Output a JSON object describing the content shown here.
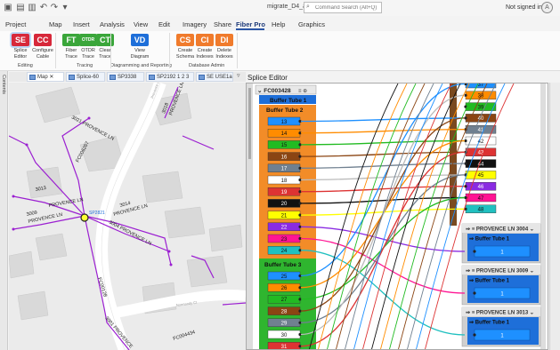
{
  "titlebar": {
    "title": "migrate_D4_alt",
    "search_placeholder": "Command Search (Alt+Q)",
    "signin": "Not signed in",
    "avatar": "A"
  },
  "tabs": [
    "Project",
    "Map",
    "Insert",
    "Analysis",
    "View",
    "Edit",
    "Imagery",
    "Share",
    "Fiber Pro",
    "Help",
    "Graphics"
  ],
  "active_tab": "Fiber Pro",
  "ribbon": {
    "buttons": [
      {
        "icon": "SE",
        "color": "#d7283a",
        "label": "Splice\nEditor"
      },
      {
        "icon": "CC",
        "color": "#d7283a",
        "label": "Configure\nCable"
      },
      {
        "icon": "FT",
        "color": "#3aa63a",
        "label": "Fiber\nTrace"
      },
      {
        "icon": "OTDR",
        "color": "#3aa63a",
        "label": "OTDR\nTrace"
      },
      {
        "icon": "CT",
        "color": "#3aa63a",
        "label": "Clear\nTrace"
      },
      {
        "icon": "VD",
        "color": "#1e6fd9",
        "label": "View\nDiagram"
      },
      {
        "icon": "CS",
        "color": "#f07b2c",
        "label": "Create\nSchema"
      },
      {
        "icon": "CI",
        "color": "#f07b2c",
        "label": "Create\nIndexes"
      },
      {
        "icon": "DI",
        "color": "#f07b2c",
        "label": "Delete\nIndexes"
      }
    ],
    "groups": [
      "Editing",
      "Tracing",
      "Diagramming and Reporting",
      "Database Admin"
    ]
  },
  "left_strip": "Contents",
  "doc_tabs": [
    "Map",
    "Splice-60",
    "SP3338",
    "SP2192 1 2 3 4",
    "SE USE1a"
  ],
  "map": {
    "labels": [
      "3021 PROVENCE LN",
      "FC006267",
      "3013",
      "PROVENCE LN",
      "3009",
      "PROVENCE LN",
      "3014",
      "PROVENCE LN",
      "3004 PROVENCE LN",
      "FC00128",
      "3001 PROVENCE",
      "Normandy Ct",
      "FC004434",
      "SP2821",
      "3018",
      "PROVENCE LN",
      "Provence Ln"
    ]
  },
  "splice": {
    "title": "Splice Editor",
    "cable_left": "FC003428",
    "cable_left_icons": "≡ ⊕",
    "tube1": "Buffer Tube 1",
    "tube2": "Buffer Tube 2",
    "tube3": "Buffer Tube 3",
    "tube2_fibers": [
      {
        "n": "13",
        "c": "#1e90ff"
      },
      {
        "n": "14",
        "c": "#ff8c00"
      },
      {
        "n": "15",
        "c": "#22bb22"
      },
      {
        "n": "16",
        "c": "#8b4513"
      },
      {
        "n": "17",
        "c": "#708090"
      },
      {
        "n": "18",
        "c": "#ffffff"
      },
      {
        "n": "19",
        "c": "#dd3333"
      },
      {
        "n": "20",
        "c": "#111111"
      },
      {
        "n": "21",
        "c": "#ffff00"
      },
      {
        "n": "22",
        "c": "#8a2be2"
      },
      {
        "n": "23",
        "c": "#ff1493"
      },
      {
        "n": "24",
        "c": "#20c0c0"
      }
    ],
    "tube3_fibers": [
      {
        "n": "25",
        "c": "#1e90ff"
      },
      {
        "n": "26",
        "c": "#ff8c00"
      },
      {
        "n": "27",
        "c": "#22bb22"
      },
      {
        "n": "28",
        "c": "#8b4513"
      },
      {
        "n": "29",
        "c": "#708090"
      },
      {
        "n": "30",
        "c": "#ffffff"
      },
      {
        "n": "31",
        "c": "#dd3333"
      }
    ],
    "right_fibers": [
      {
        "n": "37",
        "c": "#1e90ff"
      },
      {
        "n": "38",
        "c": "#ff8c00"
      },
      {
        "n": "39",
        "c": "#22bb22"
      },
      {
        "n": "40",
        "c": "#8b4513"
      },
      {
        "n": "41",
        "c": "#708090"
      },
      {
        "n": "42",
        "c": "#ffffff"
      },
      {
        "n": "43",
        "c": "#dd3333"
      },
      {
        "n": "44",
        "c": "#111111"
      },
      {
        "n": "45",
        "c": "#ffff00"
      },
      {
        "n": "46",
        "c": "#8a2be2"
      },
      {
        "n": "47",
        "c": "#ff1493"
      },
      {
        "n": "48",
        "c": "#20c0c0"
      }
    ],
    "right_cables": [
      {
        "name": "PROVENCE LN 3004",
        "tube": "Buffer Tube 1",
        "fiber": "1"
      },
      {
        "name": "PROVENCE LN 3009",
        "tube": "Buffer Tube 1",
        "fiber": "1"
      },
      {
        "name": "PROVENCE LN 3013",
        "tube": "Buffer Tube 1",
        "fiber": "1"
      }
    ]
  }
}
